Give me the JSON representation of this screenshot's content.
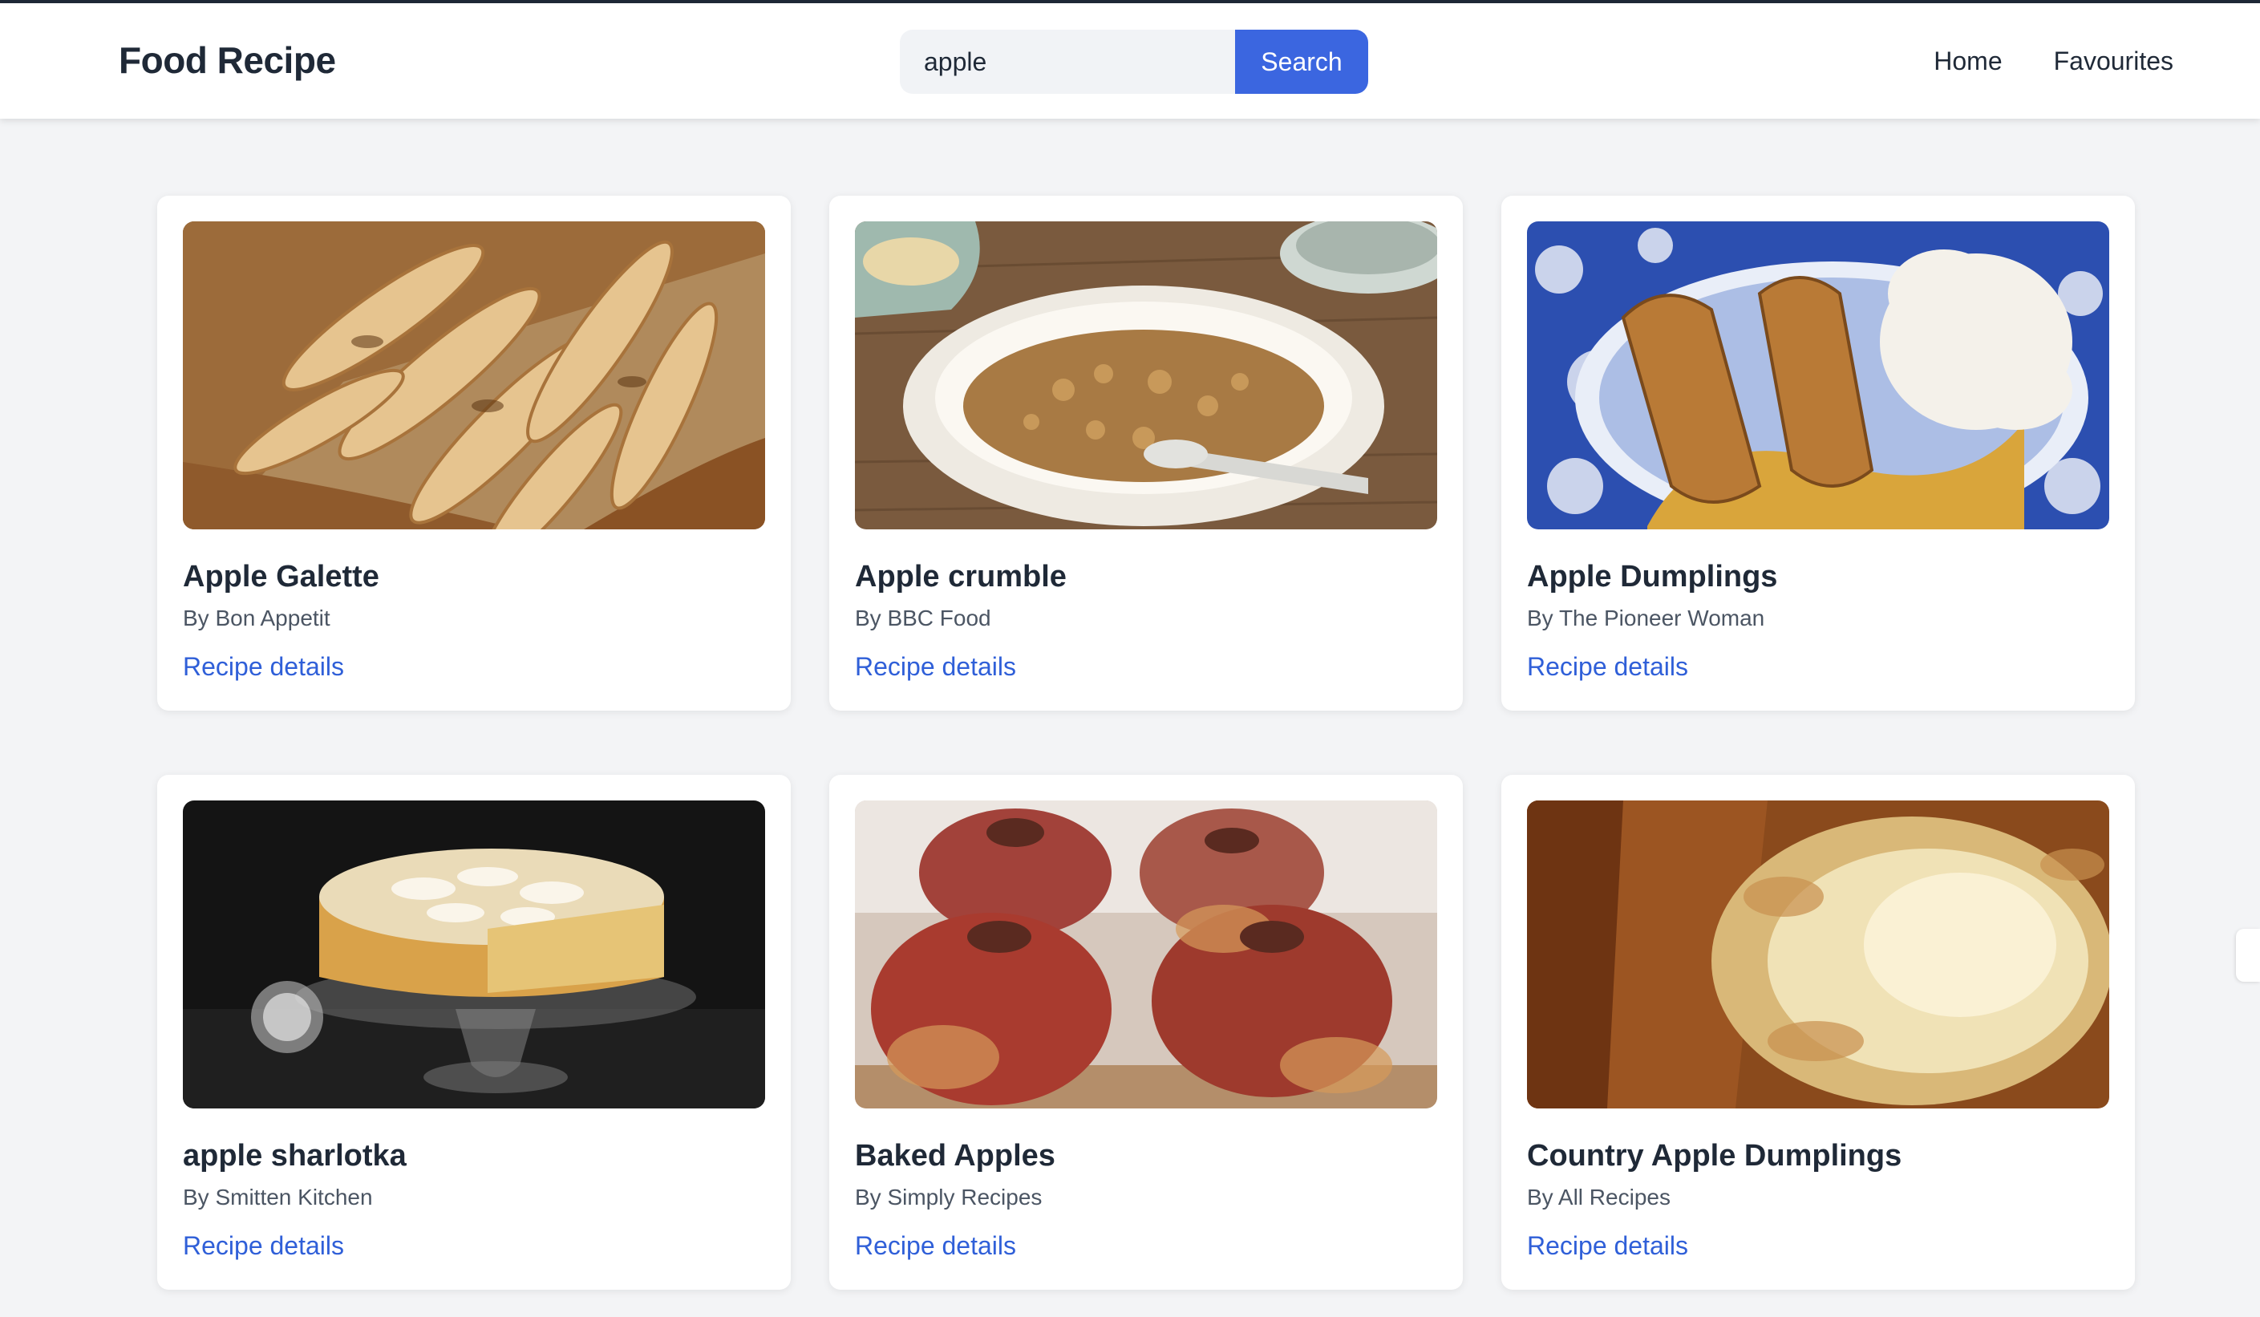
{
  "header": {
    "brand": "Food Recipe",
    "search": {
      "value": "apple",
      "button_label": "Search"
    },
    "nav": [
      {
        "label": "Home"
      },
      {
        "label": "Favourites"
      }
    ]
  },
  "recipes": [
    {
      "title": "Apple Galette",
      "author": "By Bon Appetit",
      "link_label": "Recipe details",
      "image_icon": "apple-galette-photo"
    },
    {
      "title": "Apple crumble",
      "author": "By BBC Food",
      "link_label": "Recipe details",
      "image_icon": "apple-crumble-photo"
    },
    {
      "title": "Apple Dumplings",
      "author": "By The Pioneer Woman",
      "link_label": "Recipe details",
      "image_icon": "apple-dumplings-photo"
    },
    {
      "title": "apple sharlotka",
      "author": "By Smitten Kitchen",
      "link_label": "Recipe details",
      "image_icon": "apple-sharlotka-photo"
    },
    {
      "title": "Baked Apples",
      "author": "By Simply Recipes",
      "link_label": "Recipe details",
      "image_icon": "baked-apples-photo"
    },
    {
      "title": "Country Apple Dumplings",
      "author": "By All Recipes",
      "link_label": "Recipe details",
      "image_icon": "country-apple-dumplings-photo"
    }
  ],
  "colors": {
    "accent": "#3b66e0",
    "link": "#2f5fd8",
    "page_bg": "#f3f4f6",
    "text": "#1f2937"
  }
}
